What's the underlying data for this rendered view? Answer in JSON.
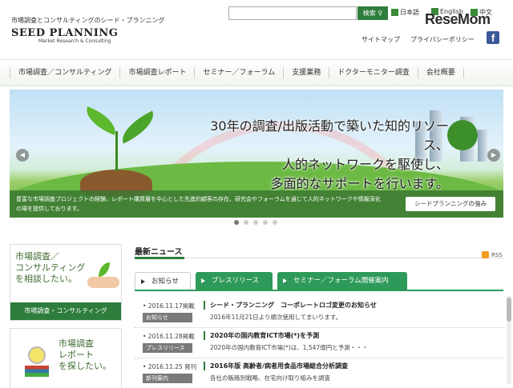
{
  "header": {
    "tagline": "市場調査とコンサルティングのシード・プランニング",
    "logo": "SEED PLANNING",
    "logo_sub": "Market Research & Consulting",
    "search_placeholder": "",
    "search_button": "検索",
    "languages": [
      "日本語",
      "English",
      "中文"
    ],
    "sitemap": "サイトマップ",
    "privacy": "プライバシーポリシー",
    "facebook_glyph": "f",
    "watermark_main": "ReseMom",
    "watermark_accent": ""
  },
  "nav": {
    "items": [
      "市場調査／コンサルティング",
      "市場調査レポート",
      "セミナー／フォーラム",
      "支援業務",
      "ドクターモニター調査",
      "会社概要"
    ]
  },
  "hero": {
    "lines": [
      "30年の調査/出版活動で築いた知的リソース、",
      "人的ネットワークを駆使し、",
      "多面的なサポートを行います。"
    ],
    "band_text": "豊富な市場調査プロジェクトの経験、レポート購買層を中心とした先進的顧客の存在、研究会やフォーラムを通じて人的ネットワークや情報深化の場を提供しております。",
    "band_button": "シードプランニングの強み",
    "arrow_left": "◀",
    "arrow_right": "▶"
  },
  "sidebar": {
    "card1_title_lines": [
      "市場調査／",
      "コンサルティング",
      "を相談したい。"
    ],
    "card1_button": "市場調査・コンサルティング",
    "card2_title_lines": [
      "市場調査",
      "レポート",
      "を探したい。"
    ]
  },
  "news": {
    "title": "最新ニュース",
    "rss": "RSS",
    "tabs": [
      "お知らせ",
      "プレスリリース",
      "セミナー／フォーラム開催案内"
    ],
    "rows": [
      {
        "date": "• 2016.11.17掲載",
        "category": "お知らせ",
        "headline": "シード・プランニング　コーポレートロゴ変更のお知らせ",
        "body": "2016年11月21日より順次使用してまいります。"
      },
      {
        "date": "• 2016.11.28掲載",
        "category": "プレスリリース",
        "headline": "2020年の国内教育ICT市場(*)を予測",
        "body": "2020年の国内教育ICT市場(*)は、1,547億円と予測・・・"
      },
      {
        "date": "• 2016.11.25 発刊",
        "category": "新刊案内",
        "headline": "2016年版 高齢者/病者用食品市場総合分析調査",
        "body": "各社の販路別戦略、在宅向け取り組みを調査"
      }
    ]
  },
  "colors": {
    "brand_green": "#2e7d3c",
    "tab_green": "#2e9a5a"
  }
}
